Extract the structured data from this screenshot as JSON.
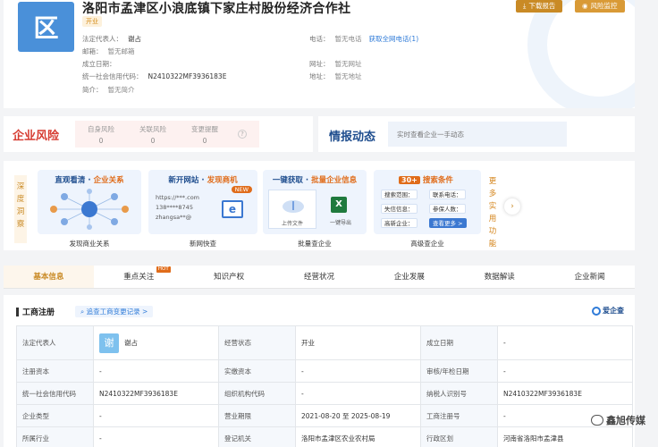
{
  "header": {
    "logo_char": "区",
    "company_name": "洛阳市孟津区小浪底镇下家庄村股份经济合作社",
    "status": "开业",
    "legal_rep_label": "法定代表人：",
    "legal_rep_value": "谢占",
    "phone_label": "电话：",
    "phone_value": "暂无电话",
    "phone_link": "获取全网电话(1)",
    "email_label": "邮箱：",
    "email_value": "暂无邮箱",
    "founded_label": "成立日期：",
    "founded_value": "",
    "website_label": "网址：",
    "website_value": "暂无网址",
    "credit_label": "统一社会信用代码：",
    "credit_value": "N2410322MF3936183E",
    "address_label": "地址：",
    "address_value": "暂无地址",
    "intro_label": "简介：",
    "intro_value": "暂无简介",
    "btn_report": "下载报告",
    "btn_monitor": "风险监控"
  },
  "risk": {
    "title": "企业风险",
    "items": [
      {
        "label": "自身风险",
        "count": "0"
      },
      {
        "label": "关联风险",
        "count": "0"
      },
      {
        "label": "变更提醒",
        "count": "0"
      }
    ],
    "help": "?"
  },
  "news": {
    "title": "情报动态",
    "placeholder": "实时查看企业一手动态"
  },
  "insight": {
    "side_left": [
      "深",
      "度",
      "洞",
      "察"
    ],
    "side_right": [
      "更",
      "多",
      "实",
      "用",
      "功",
      "能"
    ],
    "tiles": [
      {
        "title_a": "直观看清 · ",
        "title_b": "企业关系",
        "caption": "发现商业关系"
      },
      {
        "title_a": "新开网站 · ",
        "title_b": "发现商机",
        "caption": "新网快查",
        "line1": "https://***.com",
        "line2": "138****8745",
        "line3": "zhangsa**@",
        "new": "NEW",
        "e": "e"
      },
      {
        "title_a": "一键获取 · ",
        "title_b": "批量企业信息",
        "caption": "批量查企业",
        "upload": "上传文件",
        "export": "一键导出"
      },
      {
        "title_a": "30+",
        "title_b": "搜索条件",
        "caption": "高级查企业",
        "chips": [
          "搜索范围：",
          "联系电话：",
          "失信信息：",
          "参保人数：",
          "高新企业：",
          "查看更多 >"
        ]
      }
    ],
    "arrow": "›"
  },
  "tabs": [
    {
      "label": "基本信息",
      "active": true
    },
    {
      "label": "重点关注",
      "hot": "HOT"
    },
    {
      "label": "知识产权"
    },
    {
      "label": "经营状况"
    },
    {
      "label": "企业发展"
    },
    {
      "label": "数据解读"
    },
    {
      "label": "企业新闻"
    }
  ],
  "registration": {
    "title": "工商注册",
    "link": "追查工商变更记录 >",
    "brand": "爱企查",
    "rows": [
      [
        "法定代表人",
        "谢占",
        "经营状态",
        "开业",
        "成立日期",
        "-"
      ],
      [
        "注册资本",
        "-",
        "实缴资本",
        "-",
        "审核/年检日期",
        "-"
      ],
      [
        "统一社会信用代码",
        "N2410322MF3936183E",
        "组织机构代码",
        "-",
        "纳税人识别号",
        "N2410322MF3936183E"
      ],
      [
        "企业类型",
        "-",
        "营业期限",
        "2021-08-20 至 2025-08-19",
        "工商注册号",
        "-"
      ],
      [
        "所属行业",
        "-",
        "登记机关",
        "洛阳市孟津区农业农村局",
        "行政区划",
        "河南省洛阳市孟津县"
      ]
    ],
    "avatar_char": "谢"
  },
  "watermark": "鑫旭传媒"
}
